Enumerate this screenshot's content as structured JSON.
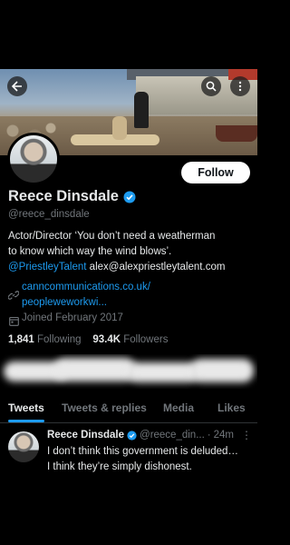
{
  "profile": {
    "name": "Reece Dinsdale",
    "handle": "@reece_dinsdale",
    "follow_label": "Follow",
    "bio_line1": "Actor/Director ‘You don’t need a weatherman",
    "bio_line2": "to know which way the wind blows’.",
    "bio_link": "@PriestleyTalent",
    "bio_email": "alex@alexpriestleytalent.com",
    "url_line1": "canncommunications.co.uk/",
    "url_line2": "peopleweworkwi...",
    "joined": "Joined February 2017",
    "following_count": "1,841",
    "following_label": "Following",
    "followers_count": "93.4K",
    "followers_label": "Followers"
  },
  "tabs": [
    "Tweets",
    "Tweets & replies",
    "Media",
    "Likes"
  ],
  "tweet": {
    "author": "Reece Dinsdale",
    "handle": "@reece_din...",
    "separator": "·",
    "time": "24m",
    "text_line1": "I don’t think this government is deluded…",
    "text_line2": "I think they’re simply dishonest."
  },
  "colors": {
    "accent": "#1d9bf0",
    "background": "#000000",
    "muted": "#71767b"
  },
  "icons": [
    "back-arrow-icon",
    "search-icon",
    "more-vertical-icon",
    "verified-badge-icon",
    "link-icon",
    "calendar-icon"
  ]
}
